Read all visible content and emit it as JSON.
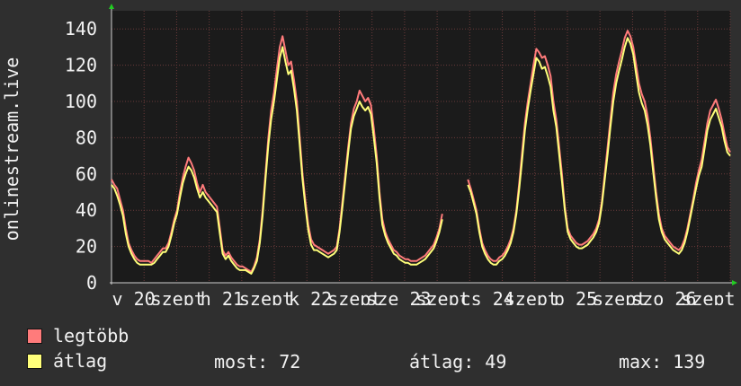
{
  "chart_data": {
    "type": "line",
    "ylabel": "onlinestream.live",
    "ylim": [
      0,
      150
    ],
    "yticks": [
      0,
      20,
      40,
      60,
      80,
      100,
      120,
      140
    ],
    "x_tick_labels": [
      "v 20",
      "szept",
      "h 21",
      "szept",
      "k 22",
      "szept",
      "sze 23",
      "szept",
      "cs 24",
      "szept",
      "p 25",
      "szept",
      "szo 26",
      "szept"
    ],
    "series": [
      {
        "name": "legtöbb",
        "color": "#ff7b7b",
        "values": [
          57,
          54,
          52,
          46,
          40,
          30,
          22,
          18,
          15,
          13,
          12,
          12,
          12,
          12,
          11,
          13,
          15,
          17,
          19,
          19,
          22,
          28,
          35,
          40,
          50,
          58,
          64,
          69,
          66,
          62,
          55,
          50,
          54,
          50,
          48,
          46,
          44,
          42,
          30,
          18,
          15,
          17,
          14,
          12,
          10,
          9,
          9,
          8,
          7,
          6,
          9,
          14,
          24,
          40,
          60,
          80,
          95,
          105,
          118,
          130,
          136,
          128,
          120,
          122,
          112,
          100,
          80,
          60,
          45,
          32,
          24,
          21,
          20,
          19,
          18,
          17,
          16,
          17,
          18,
          20,
          30,
          45,
          60,
          75,
          88,
          96,
          100,
          106,
          103,
          100,
          102,
          98,
          85,
          70,
          50,
          35,
          28,
          24,
          21,
          18,
          17,
          15,
          14,
          13,
          13,
          12,
          12,
          12,
          13,
          14,
          15,
          17,
          19,
          21,
          25,
          30,
          38,
          null,
          null,
          null,
          null,
          null,
          null,
          null,
          null,
          57,
          52,
          46,
          40,
          30,
          22,
          18,
          15,
          13,
          12,
          12,
          14,
          15,
          17,
          20,
          24,
          30,
          40,
          55,
          72,
          88,
          100,
          110,
          120,
          129,
          127,
          124,
          125,
          120,
          114,
          100,
          90,
          75,
          60,
          42,
          30,
          26,
          24,
          22,
          21,
          21,
          22,
          23,
          25,
          27,
          30,
          35,
          45,
          60,
          75,
          90,
          105,
          115,
          122,
          128,
          135,
          139,
          136,
          130,
          120,
          110,
          104,
          100,
          92,
          80,
          65,
          50,
          38,
          30,
          26,
          24,
          22,
          20,
          19,
          18,
          20,
          24,
          30,
          38,
          46,
          55,
          62,
          68,
          78,
          88,
          95,
          98,
          101,
          96,
          90,
          82,
          75,
          72
        ]
      },
      {
        "name": "átlag",
        "color": "#ffff7a",
        "values": [
          54,
          52,
          48,
          43,
          37,
          27,
          20,
          16,
          13,
          11,
          10,
          10,
          10,
          10,
          10,
          11,
          13,
          15,
          17,
          17,
          20,
          26,
          33,
          38,
          47,
          55,
          60,
          64,
          62,
          58,
          52,
          47,
          50,
          47,
          45,
          43,
          41,
          39,
          27,
          16,
          13,
          15,
          12,
          10,
          8,
          7,
          7,
          7,
          6,
          5,
          8,
          12,
          22,
          37,
          57,
          76,
          90,
          100,
          112,
          124,
          130,
          122,
          115,
          117,
          107,
          95,
          76,
          57,
          42,
          29,
          21,
          18,
          18,
          17,
          16,
          15,
          14,
          15,
          16,
          18,
          28,
          42,
          57,
          72,
          85,
          92,
          96,
          100,
          97,
          95,
          97,
          93,
          80,
          66,
          47,
          32,
          26,
          22,
          19,
          16,
          15,
          13,
          12,
          11,
          11,
          10,
          10,
          10,
          11,
          12,
          13,
          15,
          17,
          19,
          23,
          28,
          35,
          null,
          null,
          null,
          null,
          null,
          null,
          null,
          null,
          54,
          50,
          44,
          38,
          28,
          20,
          16,
          13,
          11,
          10,
          10,
          12,
          13,
          15,
          18,
          22,
          28,
          38,
          52,
          68,
          84,
          96,
          106,
          115,
          124,
          122,
          118,
          119,
          114,
          108,
          95,
          86,
          71,
          56,
          40,
          28,
          24,
          22,
          20,
          19,
          19,
          20,
          21,
          23,
          25,
          28,
          33,
          43,
          57,
          71,
          86,
          100,
          110,
          117,
          123,
          130,
          135,
          132,
          126,
          115,
          105,
          99,
          95,
          87,
          76,
          61,
          47,
          35,
          28,
          24,
          22,
          20,
          18,
          17,
          16,
          18,
          22,
          28,
          36,
          44,
          52,
          59,
          64,
          74,
          84,
          90,
          93,
          96,
          91,
          86,
          78,
          72,
          70
        ]
      }
    ]
  },
  "legend": {
    "max_label": "legtöbb",
    "avg_label": "átlag"
  },
  "stats": {
    "now": "most: 72",
    "avg": "átlag: 49",
    "max": "max: 139"
  }
}
